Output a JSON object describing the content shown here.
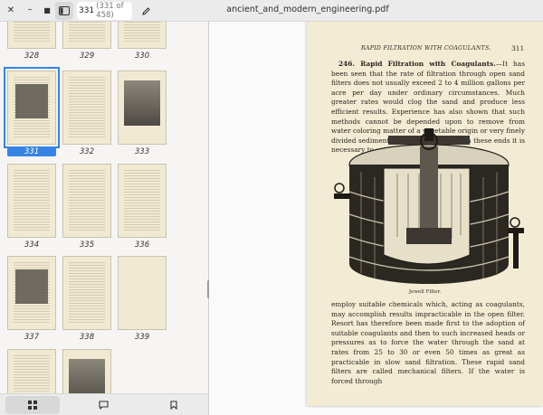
{
  "header": {
    "page_current": "331",
    "page_of": "(331 of 458)",
    "doc_title": "ancient_and_modern_engineering.pdf"
  },
  "sidebar": {
    "thumbnails": [
      {
        "label": "328",
        "kind": "text"
      },
      {
        "label": "329",
        "kind": "text"
      },
      {
        "label": "330",
        "kind": "text"
      },
      {
        "label": "331",
        "kind": "picture",
        "selected": true
      },
      {
        "label": "332",
        "kind": "text"
      },
      {
        "label": "333",
        "kind": "photo"
      },
      {
        "label": "334",
        "kind": "text"
      },
      {
        "label": "335",
        "kind": "text"
      },
      {
        "label": "336",
        "kind": "text"
      },
      {
        "label": "337",
        "kind": "picture"
      },
      {
        "label": "338",
        "kind": "text"
      },
      {
        "label": "339",
        "kind": "blank"
      },
      {
        "label": "",
        "kind": "text"
      },
      {
        "label": "",
        "kind": "photo"
      }
    ]
  },
  "page": {
    "running_head": "RAPID FILTRATION WITH COAGULANTS.",
    "page_number": "311",
    "para1_heading": "246. Rapid Filtration with Coagulants.",
    "para1_body": "—It has been seen that the rate of filtration through open sand filters does not usually exceed 2 to 4 million gallons per acre per day under ordinary circumstances. Much greater rates would clog the sand and produce less efficient results. Experience has also shown that such methods cannot be depended upon to remove from water coloring matter of a vegetable origin or very finely divided sediment. In order to accomplish these ends it is necessary to",
    "figure_caption": "Jewell Filter.",
    "para2": "employ suitable chemicals which, acting as coagulants, may accomplish results impracticable in the open filter. Resort has therefore been made first to the adoption of suitable coagulants and then to such increased heads or pressures as to force the water through the sand at rates from 25 to 30 or even 50 times as great as practicable in slow sand filtration. These rapid sand filters are called mechanical filters. If the water is forced through"
  },
  "colors": {
    "accent": "#3584e4",
    "paper": "#f3ecd4"
  },
  "icons": [
    "close-icon",
    "minimize-icon",
    "maximize-icon",
    "sidebar-toggle-icon",
    "pencil-icon",
    "grid-icon",
    "comment-icon",
    "bookmark-icon"
  ]
}
